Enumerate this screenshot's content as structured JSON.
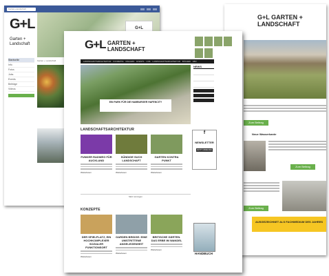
{
  "left": {
    "logo": "G+L",
    "page_name": "Garten +\nLandschaft",
    "search_placeholder": "Garten+Landschaft",
    "cover_tile": "G+L",
    "sidebar": [
      "Startseite",
      "Info",
      "Fotos",
      "Jobs",
      "Events",
      "Beiträge",
      "Videos"
    ],
    "feed_caption": "Garten + Landschaft"
  },
  "right": {
    "logo": "G+L GARTEN + LANDSCHAFT",
    "buttons": [
      "Zum Beitrag",
      "Zum Beitrag",
      "Zum Beitrag"
    ],
    "headline": "Neue Wasserkante",
    "award": "AUSGEZEICHNET ALS FACHMEDIUM DES JAHRES"
  },
  "center": {
    "logo": "G+L",
    "title_line1": "GARTEN +",
    "title_line2": "LANDSCHAFT",
    "nav": [
      "LANDSCHAFTSARCHITEKTUR",
      "KONZEPTE",
      "MAGAZIN",
      "EVENTS",
      "LIVE",
      "LANDSCHAFTSARCHITEKTUR",
      "BÜCHER",
      "ABO"
    ],
    "hero_caption": "EIN PARK FÜR DIE HAMBURGER HAFENCITY",
    "news_heading": "NEWS",
    "section1": "LANDSCHAFTSARCHITEKTUR",
    "cards1": [
      {
        "title": "FUNKER RADWEG FÜR AUCKLAND",
        "color": "#7b3aa8",
        "more": "Weiterlesen"
      },
      {
        "title": "SÜNDIGE SUCH LANDSCHAFT",
        "color": "#6f7b3c",
        "more": "Weiterlesen"
      },
      {
        "title": "GARTEN KONTRA PUNKT",
        "color": "#7f9a5e",
        "more": "Weiterlesen"
      }
    ],
    "newsletter_icon": "f",
    "newsletter_title": "NEWSLETTER",
    "newsletter_button": "JETZT ANMELDEN",
    "load_more": "Mehr anzeigen",
    "section2": "KONZEPTE",
    "cards2": [
      {
        "title": "DER SPIELPLATZ, EIN HOCHKOMPLEXER SOZIALER FUNKTIONSORT",
        "color": "#c9a25c",
        "more": "Weiterlesen"
      },
      {
        "title": "GARDEN BRIDGE: EINE UMSTRITTENE ANGELEGENHEIT",
        "color": "#8fa0a8",
        "more": "Weiterlesen"
      },
      {
        "title": "BRITISCHE GÄRTEN. DAS ERBE IM WANDEL",
        "color": "#8aa55a",
        "more": "Weiterlesen"
      }
    ],
    "handbook": "HANDBUCH"
  },
  "colors": {
    "accent_green": "#6ab04c",
    "nav_dark": "#1c1c1c",
    "fb_blue": "#3b5998",
    "award_yellow": "#f6c623"
  }
}
